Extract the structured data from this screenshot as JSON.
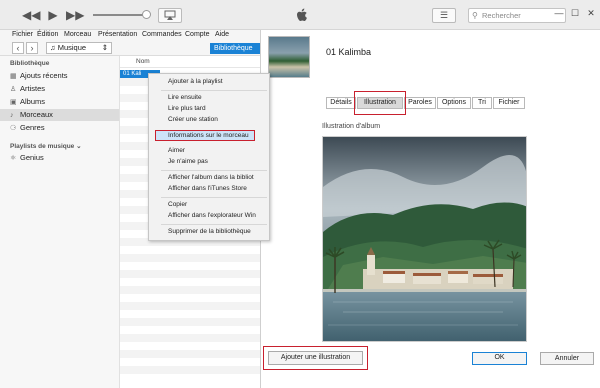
{
  "titlebar": {
    "rewind_icon": "rewind-icon",
    "play_icon": "play-icon",
    "forward_icon": "fast-forward-icon",
    "search_placeholder": "Rechercher",
    "minimize": "—",
    "maximize": "☐",
    "close": "✕"
  },
  "menubar": {
    "items": [
      "Fichier",
      "Édition",
      "Morceau",
      "Présentation",
      "Commandes",
      "Compte",
      "Aide"
    ]
  },
  "navrow": {
    "back": "‹",
    "forward": "›",
    "media": "Musique",
    "library_button": "Bibliothèque"
  },
  "sidebar": {
    "library_header": "Bibliothèque",
    "items": [
      {
        "label": "Ajouts récents",
        "icon": "recent-icon"
      },
      {
        "label": "Artistes",
        "icon": "artist-icon"
      },
      {
        "label": "Albums",
        "icon": "album-icon"
      },
      {
        "label": "Morceaux",
        "icon": "note-icon"
      },
      {
        "label": "Genres",
        "icon": "genre-icon"
      }
    ],
    "playlists_header": "Playlists de musique ⌄",
    "playlists": [
      {
        "label": "Genius",
        "icon": "genius-icon"
      }
    ]
  },
  "list": {
    "column_name": "Nom",
    "selected_row": "01 Kali"
  },
  "context_menu": {
    "items": [
      "Ajouter à la playlist",
      "Lire ensuite",
      "Lire plus tard",
      "Créer une station",
      "Informations sur le morceau",
      "Aimer",
      "Je n'aime pas",
      "Afficher l'album dans la bibliot",
      "Afficher dans l'iTunes Store",
      "Copier",
      "Afficher dans l'explorateur Win",
      "Supprimer de la bibliothèque"
    ]
  },
  "dialog": {
    "track_title": "01 Kalimba",
    "tabs": [
      "Détails",
      "Illustration",
      "Paroles",
      "Options",
      "Tri",
      "Fichier"
    ],
    "active_tab": "Illustration",
    "artwork_label": "Illustration d'album",
    "add_artwork": "Ajouter une illustration",
    "ok": "OK",
    "cancel": "Annuler"
  },
  "colors": {
    "accent": "#1a82d5",
    "highlight_frame": "#c8202e"
  }
}
